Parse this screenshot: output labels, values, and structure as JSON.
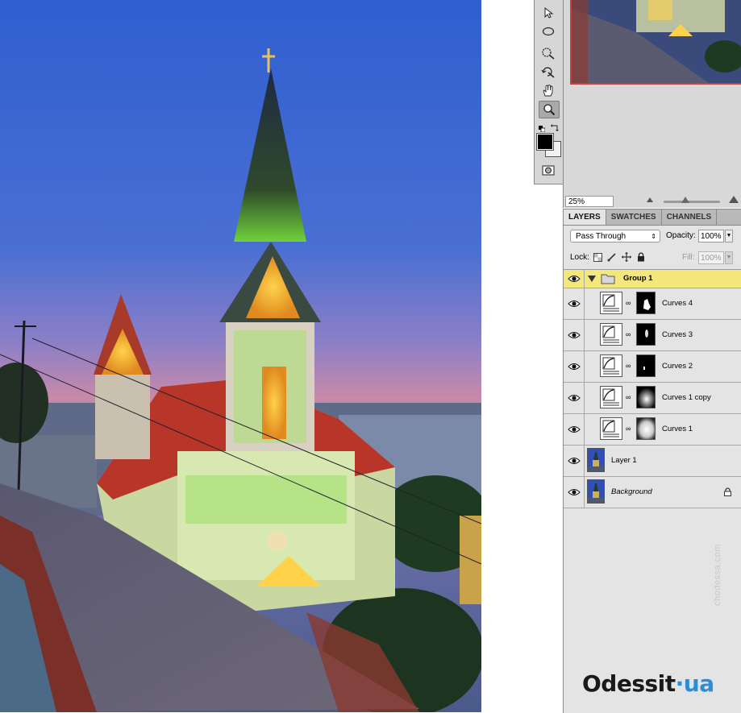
{
  "navigator": {
    "zoom": "25%"
  },
  "layers_panel": {
    "tabs": [
      "LAYERS",
      "SWATCHES",
      "CHANNELS"
    ],
    "blend_mode": "Pass Through",
    "opacity_label": "Opacity:",
    "opacity_value": "100%",
    "lock_label": "Lock:",
    "fill_label": "Fill:",
    "fill_value": "100%",
    "layers": [
      {
        "name": "Group 1",
        "type": "group",
        "expanded": true
      },
      {
        "name": "Curves 4",
        "type": "curves"
      },
      {
        "name": "Curves 3",
        "type": "curves"
      },
      {
        "name": "Curves 2",
        "type": "curves"
      },
      {
        "name": "Curves 1 copy",
        "type": "curves"
      },
      {
        "name": "Curves 1",
        "type": "curves"
      },
      {
        "name": "Layer 1",
        "type": "pixel"
      },
      {
        "name": "Background",
        "type": "background",
        "locked": true
      }
    ]
  },
  "watermark": {
    "side_text": "chodessa.com",
    "logo_main": "Odessit",
    "logo_dot": "·",
    "logo_suffix": "ua"
  },
  "colors": {
    "group_highlight": "#f4e77c",
    "navigator_frame": "#c94040",
    "logo_accent": "#2a8fd8"
  }
}
